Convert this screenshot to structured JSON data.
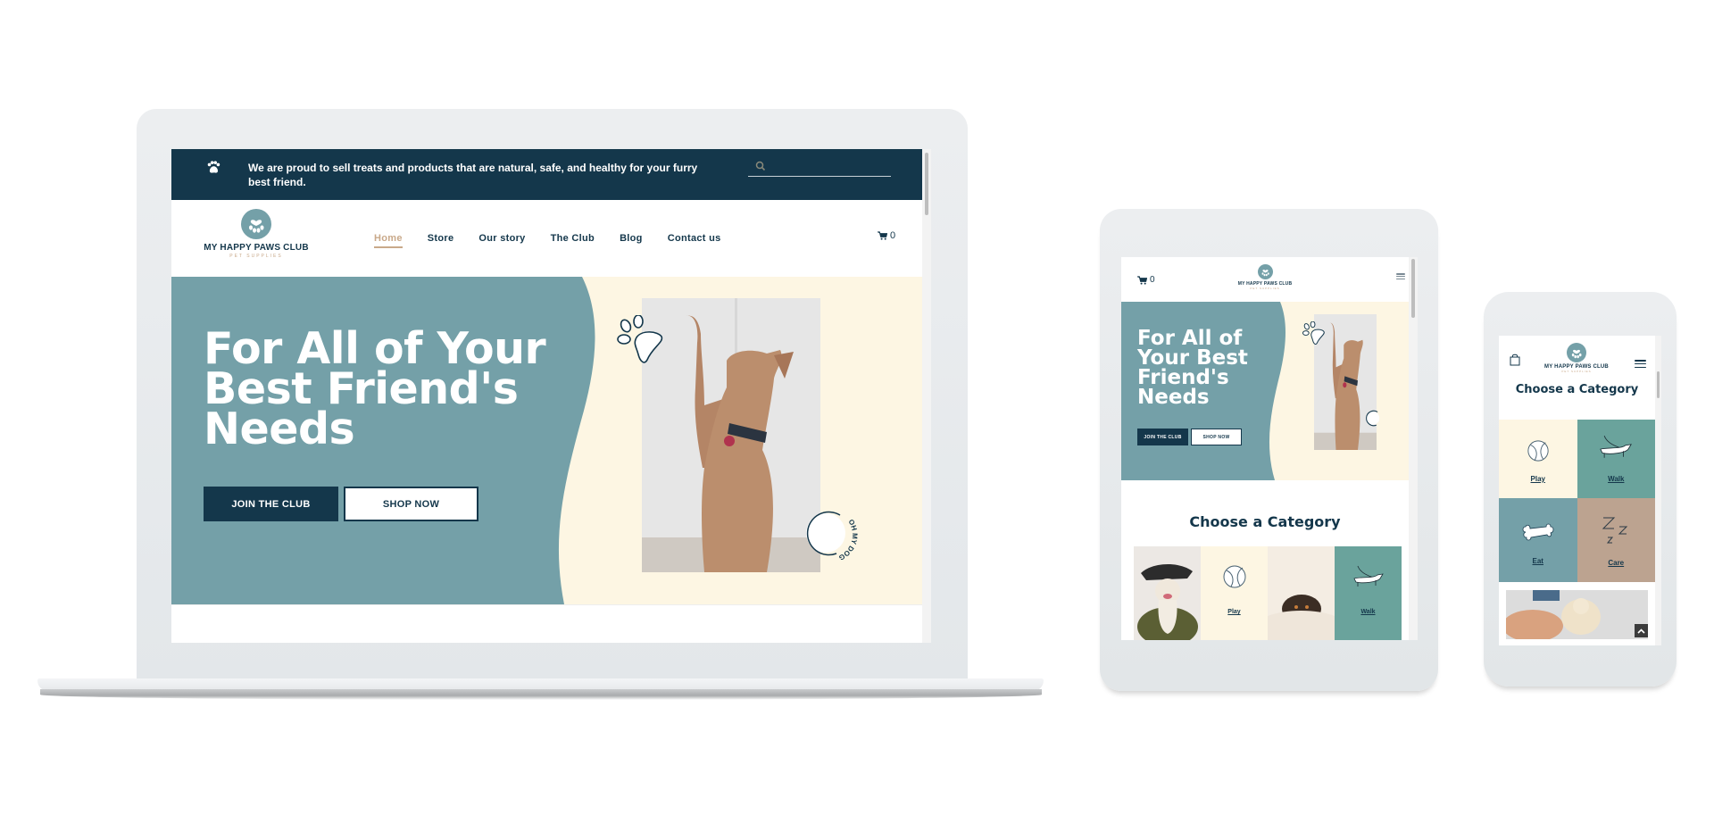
{
  "colors": {
    "navy": "#14374b",
    "teal": "#74a0a8",
    "cream": "#fdf6e3",
    "green_teal": "#6aa39c",
    "tan": "#bca390",
    "accent_tan": "#c9a98a"
  },
  "site": {
    "brand_name": "MY HAPPY PAWS CLUB",
    "brand_tagline": "PET SUPPLIES",
    "announcement": "We are proud to sell treats and products that are natural, safe, and healthy for your furry best friend.",
    "search_placeholder": "",
    "nav": [
      {
        "label": "Home",
        "active": true
      },
      {
        "label": "Store",
        "active": false
      },
      {
        "label": "Our story",
        "active": false
      },
      {
        "label": "The Club",
        "active": false
      },
      {
        "label": "Blog",
        "active": false
      },
      {
        "label": "Contact us",
        "active": false
      }
    ],
    "cart_count": "0",
    "hero": {
      "headline_desktop": "For All of Your Best Friend's Needs",
      "headline_tablet": "For All of Your  Best Friend's Needs",
      "primary_cta": "JOIN THE CLUB",
      "secondary_cta": "SHOP NOW",
      "badge_text": "OH MY DOG"
    },
    "categories_title": "Choose a Category",
    "categories": [
      {
        "label": "Play",
        "icon": "tennis-ball-icon",
        "color": "#fdf6e3"
      },
      {
        "label": "Walk",
        "icon": "dachshund-leash-icon",
        "color": "#6aa39c"
      },
      {
        "label": "Eat",
        "icon": "bone-icon",
        "color": "#74a0a8"
      },
      {
        "label": "Care",
        "icon": "sleep-zzz-icon",
        "color": "#bca390"
      }
    ]
  },
  "devices": [
    "laptop",
    "tablet",
    "phone"
  ]
}
